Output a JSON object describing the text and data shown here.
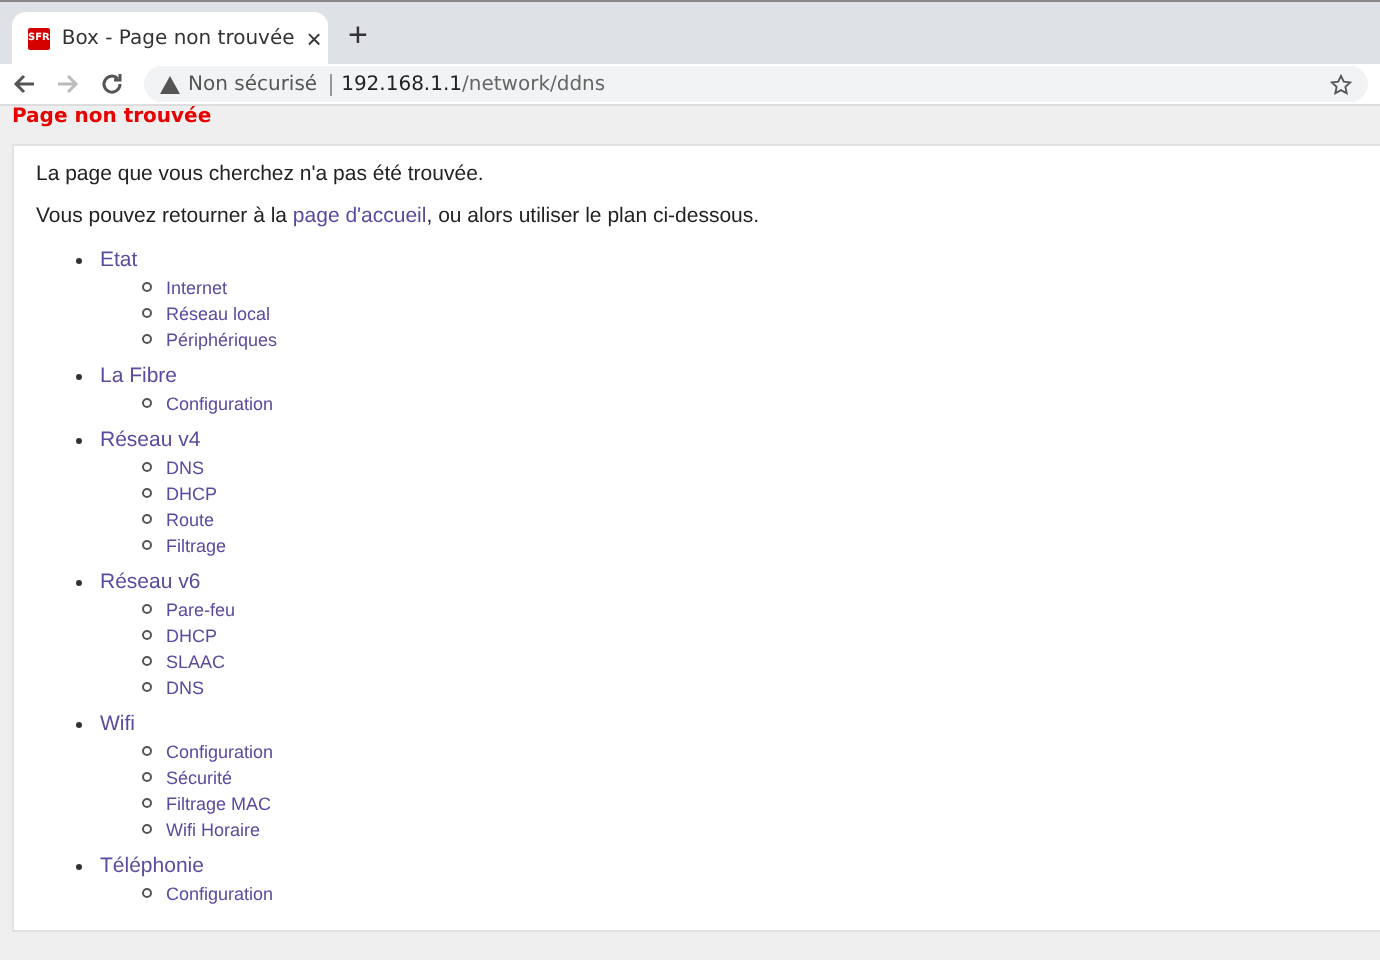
{
  "browser": {
    "tab": {
      "title": "Box - Page non trouvée",
      "favicon": "SFR",
      "close": "×"
    },
    "new_tab": "+",
    "security": "Non sécurisé",
    "url_host": "192.168.1.1",
    "url_path": "/network/ddns"
  },
  "page": {
    "heading": "Page non trouvée",
    "message": "La page que vous cherchez n'a pas été trouvée.",
    "return_before": "Vous pouvez retourner à la ",
    "return_link": "page d'accueil",
    "return_after": ", ou alors utiliser le plan ci-dessous.",
    "sitemap": [
      {
        "label": "Etat",
        "children": [
          {
            "label": "Internet"
          },
          {
            "label": "Réseau local"
          },
          {
            "label": "Périphériques"
          }
        ]
      },
      {
        "label": "La Fibre",
        "children": [
          {
            "label": "Configuration"
          }
        ]
      },
      {
        "label": "Réseau v4",
        "children": [
          {
            "label": "DNS"
          },
          {
            "label": "DHCP"
          },
          {
            "label": "Route"
          },
          {
            "label": "Filtrage"
          }
        ]
      },
      {
        "label": "Réseau v6",
        "children": [
          {
            "label": "Pare-feu"
          },
          {
            "label": "DHCP"
          },
          {
            "label": "SLAAC"
          },
          {
            "label": "DNS"
          }
        ]
      },
      {
        "label": "Wifi",
        "children": [
          {
            "label": "Configuration"
          },
          {
            "label": "Sécurité"
          },
          {
            "label": "Filtrage MAC"
          },
          {
            "label": "Wifi Horaire"
          }
        ]
      },
      {
        "label": "Téléphonie",
        "children": [
          {
            "label": "Configuration"
          }
        ]
      }
    ]
  }
}
